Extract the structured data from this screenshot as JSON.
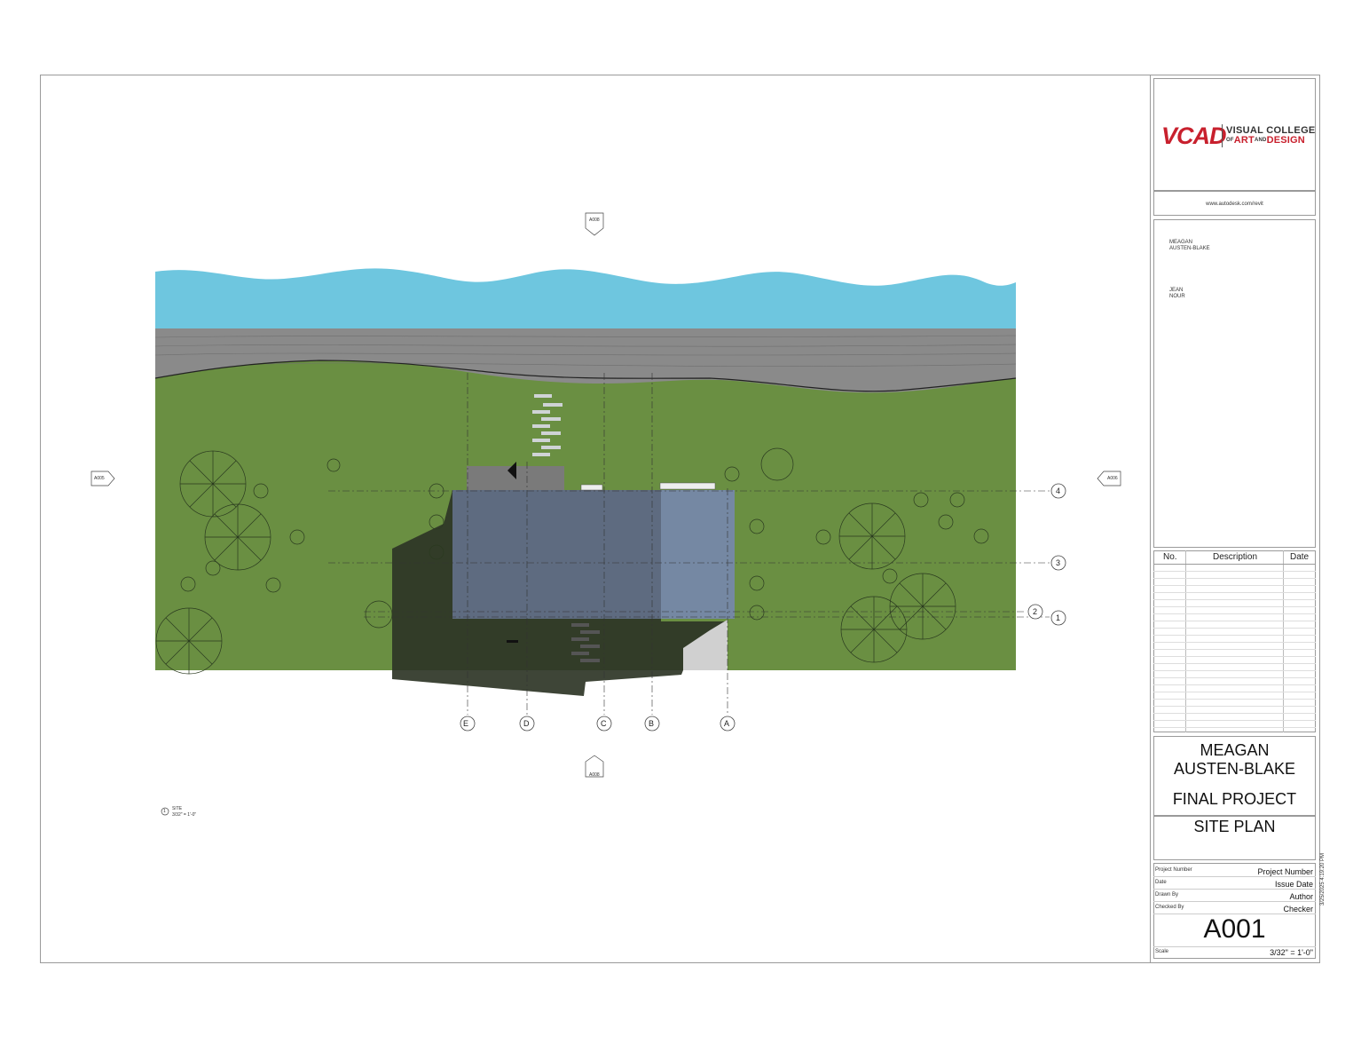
{
  "title_block": {
    "logo": {
      "mark": "VCAD",
      "line1": "VISUAL COLLEGE",
      "line2_prefix": "OF",
      "line2_art": "ART",
      "line2_and": "AND",
      "line2_design": "DESIGN"
    },
    "website": "www.autodesk.com/revit",
    "client_line1": "MEAGAN",
    "client_line2": "AUSTEN-BLAKE",
    "consultant_line1": "JEAN",
    "consultant_line2": "NOUR",
    "revisions": {
      "col_no": "No.",
      "col_desc": "Description",
      "col_date": "Date"
    },
    "project_name_line1": "MEAGAN",
    "project_name_line2": "AUSTEN-BLAKE",
    "project_title": "FINAL PROJECT",
    "sheet_title": "SITE PLAN",
    "fields": [
      {
        "label": "Project Number",
        "value": "Project Number"
      },
      {
        "label": "Date",
        "value": "Issue Date"
      },
      {
        "label": "Drawn By",
        "value": "Author"
      },
      {
        "label": "Checked By",
        "value": "Checker"
      }
    ],
    "sheet_number": "A001",
    "scale_label": "Scale",
    "scale_value": "3/32\" = 1'-0\"",
    "timestamp": "3/25/2025 4:19:20 PM"
  },
  "drawing": {
    "grid_letters": [
      "E",
      "D",
      "C",
      "B",
      "A"
    ],
    "grid_numbers": [
      "4",
      "3",
      "2",
      "1"
    ],
    "section_tag": "A008",
    "section_tag_left": "A005",
    "section_tag_right": "A006",
    "view_number": "1",
    "view_name": "SITE",
    "view_scale": "3/32\" = 1'-0\"",
    "colors": {
      "water": "#6ec6df",
      "road": "#8a8a8a",
      "grass": "#6a8f42",
      "roof": "#5e6b80",
      "roof_light": "#7588a3",
      "shadow": "#2e3526"
    }
  }
}
